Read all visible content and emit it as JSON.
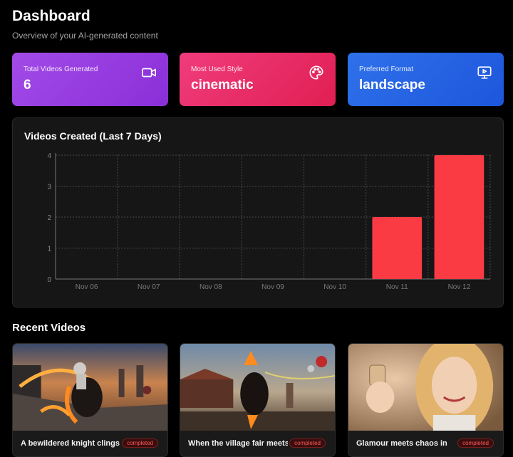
{
  "header": {
    "title": "Dashboard",
    "subtitle": "Overview of your AI-generated content"
  },
  "stats": [
    {
      "label": "Total Videos Generated",
      "value": "6",
      "icon": "video-camera-icon",
      "color": "#9b3ee6"
    },
    {
      "label": "Most Used Style",
      "value": "cinematic",
      "icon": "palette-icon",
      "color": "#ea2c63"
    },
    {
      "label": "Preferred Format",
      "value": "landscape",
      "icon": "monitor-play-icon",
      "color": "#2563eb"
    }
  ],
  "chart_data": {
    "type": "bar",
    "title": "Videos Created (Last 7 Days)",
    "categories": [
      "Nov 06",
      "Nov 07",
      "Nov 08",
      "Nov 09",
      "Nov 10",
      "Nov 11",
      "Nov 12"
    ],
    "values": [
      0,
      0,
      0,
      0,
      0,
      2,
      4
    ],
    "ylim": [
      0,
      4
    ],
    "yticks": [
      "0",
      "1",
      "2",
      "3",
      "4"
    ],
    "grid": true,
    "bar_color": "#fb3b44"
  },
  "recent": {
    "title": "Recent Videos",
    "videos": [
      {
        "title": "A bewildered knight clings",
        "status": "completed"
      },
      {
        "title": "When the village fair meets",
        "status": "completed"
      },
      {
        "title": "Glamour meets chaos in",
        "status": "completed"
      }
    ]
  }
}
